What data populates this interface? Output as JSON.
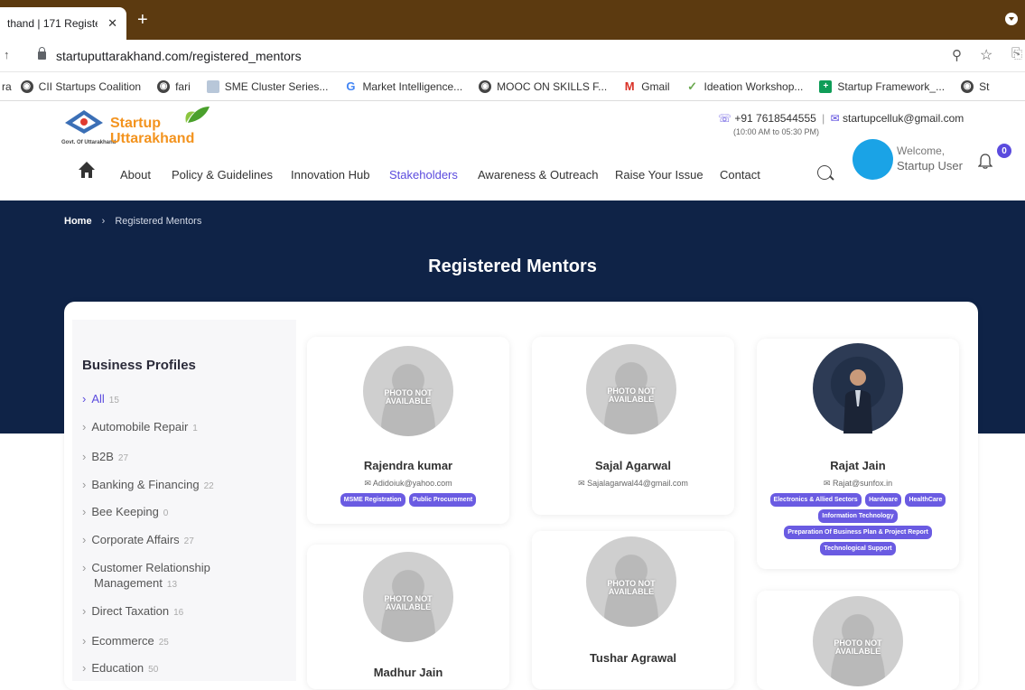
{
  "browser": {
    "tab_title": "thand | 171 Registe",
    "url": "startuputtarakhand.com/registered_mentors",
    "bookmarks": [
      "ra",
      "CII Startups Coalition",
      "fari",
      "SME Cluster Series...",
      "Market Intelligence...",
      "MOOC ON SKILLS F...",
      "Gmail",
      "Ideation Workshop...",
      "Startup Framework_...",
      "St"
    ]
  },
  "header": {
    "logo_line1": "Startup",
    "logo_line2": "Uttarakhand",
    "logo_sub": "Govt. Of Uttarakhand",
    "phone": "+91 7618544555",
    "email": "startupcelluk@gmail.com",
    "hours": "(10:00 AM to 05:30 PM)",
    "nav": [
      "About",
      "Policy & Guidelines",
      "Innovation Hub",
      "Stakeholders",
      "Awareness & Outreach",
      "Raise Your Issue",
      "Contact"
    ],
    "active_nav": "Stakeholders",
    "welcome": "Welcome,",
    "user": "Startup User",
    "notifications": "0"
  },
  "banner": {
    "home": "Home",
    "crumb": "Registered Mentors",
    "title": "Registered Mentors"
  },
  "sidebar": {
    "heading": "Business Profiles",
    "categories": [
      {
        "label": "All",
        "count": "15"
      },
      {
        "label": "Automobile Repair",
        "count": "1"
      },
      {
        "label": "B2B",
        "count": "27"
      },
      {
        "label": "Banking & Financing",
        "count": "22"
      },
      {
        "label": "Bee Keeping",
        "count": "0"
      },
      {
        "label": "Corporate Affairs",
        "count": "27"
      },
      {
        "label": "Customer Relationship",
        "label2": "Management",
        "count": "13"
      },
      {
        "label": "Direct Taxation",
        "count": "16"
      },
      {
        "label": "Ecommerce",
        "count": "25"
      },
      {
        "label": "Education",
        "count": "50"
      }
    ]
  },
  "mentors": [
    {
      "name": "Rajendra kumar",
      "email": "Adidoiuk@yahoo.com",
      "tags": [
        "MSME Registration",
        "Public Procurement"
      ],
      "photo": "PHOTO NOT AVAILABLE"
    },
    {
      "name": "Sajal Agarwal",
      "email": "Sajalagarwal44@gmail.com",
      "tags": [],
      "photo": "PHOTO NOT AVAILABLE"
    },
    {
      "name": "Rajat Jain",
      "email": "Rajat@sunfox.in",
      "tags": [
        "Electronics & Allied Sectors",
        "Hardware",
        "HealthCare",
        "Information Technology",
        "Preparation Of Business Plan & Project Report",
        "Technological Support"
      ],
      "photo": ""
    },
    {
      "name": "Madhur Jain",
      "email": "",
      "tags": [],
      "photo": "PHOTO NOT AVAILABLE"
    },
    {
      "name": "Tushar Agrawal",
      "email": "",
      "tags": [],
      "photo": "PHOTO NOT AVAILABLE"
    },
    {
      "name": "",
      "email": "",
      "tags": [],
      "photo": "PHOTO NOT AVAILABLE"
    }
  ],
  "colors": {
    "accent": "#5b4bde",
    "banner": "#0f2347",
    "tab_bar": "#5c3a10",
    "logo_orange": "#f3931e"
  }
}
